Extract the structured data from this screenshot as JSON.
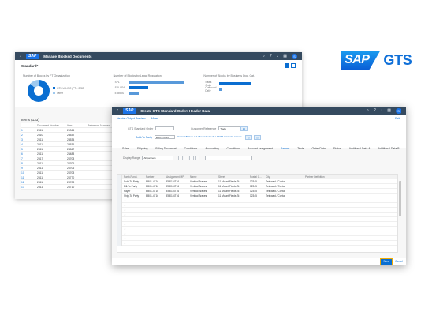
{
  "logo": {
    "sap": "SAP",
    "gts": "GTS"
  },
  "win1": {
    "title": "Manage Blocked Documents",
    "brand": "SAP",
    "view_title": "Standard*",
    "tiles": [
      {
        "title": "Number of Blocks by FT Organization",
        "legend": [
          "GTS US-INC (FT...  2283",
          "Other"
        ]
      },
      {
        "title": "Number of Blocks by Legal Regulation",
        "bars": [
          "SPL",
          "SPLUSA",
          "EMBUS"
        ]
      },
      {
        "title": "Number of Blocks by Business Doc. Cat.",
        "bars": [
          "Sales Order",
          "Outbound Deliv"
        ]
      }
    ],
    "items_title": "Items (133)",
    "table": {
      "headers": [
        "",
        "Document Number",
        "Item",
        "Reference Number"
      ],
      "rows": [
        [
          "1",
          "2311",
          "20066",
          ""
        ],
        [
          "2",
          "2310",
          "24532",
          ""
        ],
        [
          "3",
          "2311",
          "24534",
          ""
        ],
        [
          "4",
          "2311",
          "24536",
          ""
        ],
        [
          "5",
          "2311",
          "24567",
          ""
        ],
        [
          "6",
          "2311",
          "24483",
          ""
        ],
        [
          "7",
          "2317",
          "24708",
          ""
        ],
        [
          "8",
          "2311",
          "24706",
          ""
        ],
        [
          "9",
          "2311",
          "24706",
          ""
        ],
        [
          "10",
          "2311",
          "24708",
          ""
        ],
        [
          "11",
          "2311",
          "24770",
          ""
        ],
        [
          "12",
          "2311",
          "24708",
          ""
        ],
        [
          "13",
          "2311",
          "24710",
          ""
        ]
      ]
    }
  },
  "win2": {
    "title": "Create GTS Standard Order: Header Data",
    "brand": "SAP",
    "crumb": "Header Output Preview",
    "crumb_more": "More",
    "exit": "Exit",
    "fields": {
      "order_type_label": "GTS Standard Order",
      "order_type_value": "",
      "cust_ref_label": "Customer Reference",
      "cust_ref_value": "Trade",
      "sold_to_label": "Sold-To Party",
      "sold_to_value": "EBO1-4T16",
      "sold_to_link": "Vertical Brakes / 11 Mount Fields St / 12345 Zeinwald / Conta"
    },
    "tabs": [
      "Sales",
      "Shipping",
      "Billing Document",
      "Conditions",
      "Accounting",
      "Conditions",
      "Account Assignment",
      "Partner",
      "Texts",
      "Order Data",
      "Status",
      "Additional Data A",
      "Additional Data B"
    ],
    "active_tab": "Partner",
    "display_range_label": "Display Range",
    "display_range_value": "All partners",
    "grid_headers": [
      "Partn.Funct.",
      "Partner",
      "Assignment MP",
      "Name",
      "Street",
      "Postal C...",
      "City",
      "Partner Definition"
    ],
    "grid_rows": [
      [
        "Sold-To Party",
        "EB01-4T16",
        "EB01-4T16",
        "Vertical Brakes",
        "11 Mount Fields St",
        "12345",
        "Zeinwald / Conta",
        ""
      ],
      [
        "Bill-To Party",
        "EB01-4T16",
        "EB01-4T16",
        "Vertical Brakes",
        "11 Mount Fields St",
        "12345",
        "Zeinwald / Conta",
        ""
      ],
      [
        "Payer",
        "EB01-4T16",
        "EB01-4T16",
        "Vertical Brakes",
        "11 Mount Fields St",
        "12345",
        "Zeinwald / Conta",
        ""
      ],
      [
        "Ship-To Party",
        "EB01-4T16",
        "EB01-4T16",
        "Vertical Brakes",
        "11 Mount Fields St",
        "12345",
        "Zeinwald / Conta",
        ""
      ]
    ],
    "empty_rows": 10,
    "save": "Save",
    "cancel": "Cancel"
  }
}
